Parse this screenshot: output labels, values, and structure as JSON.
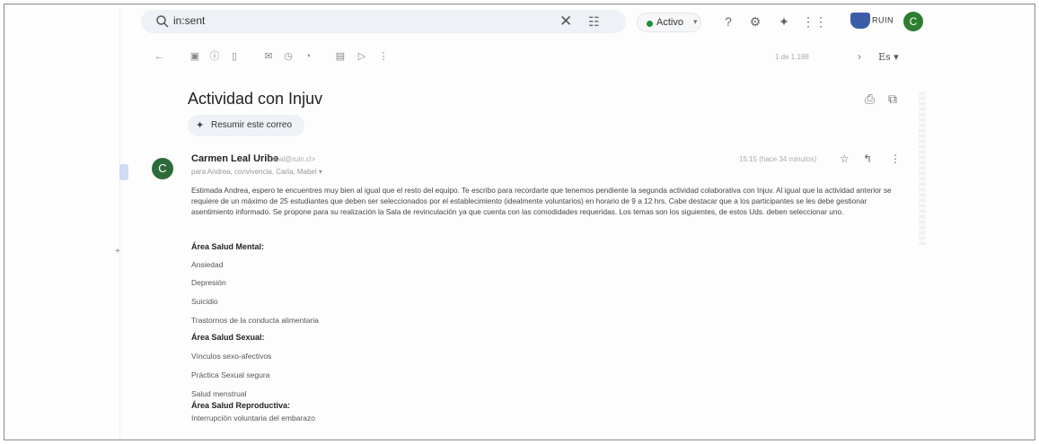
{
  "search": {
    "query": "in:sent",
    "search_icon": "search-icon",
    "clear_icon": "close-icon",
    "filter_icon": "tune-icon"
  },
  "status": {
    "label": "Activo",
    "color": "#1e8e3e"
  },
  "header_icons": [
    "help-icon",
    "settings-icon",
    "gemini-icon",
    "apps-icon"
  ],
  "brand": {
    "label": "RUIN"
  },
  "account": {
    "initial": "C",
    "color": "#2e7d32"
  },
  "toolbar": {
    "icons": [
      "back-icon",
      "archive-icon",
      "report-icon",
      "delete-icon",
      "mark-unread-icon",
      "snooze-icon",
      "add-task-icon",
      "move-icon",
      "label-icon",
      "more-icon"
    ],
    "pager": "1 de 1.188",
    "language": "Es"
  },
  "email": {
    "subject": "Actividad con Injuv",
    "summarize_label": "Resumir este correo",
    "sender_initial": "C",
    "sender_name": "Carmen Leal Uribe",
    "sender_email": "<cleal@ruin.cl>",
    "recipients": "para Andrea, convivencia, Carla, Mabel",
    "time": "15:15 (hace 34 minutos)",
    "body": "Estimada Andrea, espero te encuentres muy bien al igual que el resto del equipo. Te escribo para recordarte que tenemos pendiente la segunda actividad colaborativa con Injuv. Al igual que la actividad anterior se requiere de un máximo de 25 estudiantes que deben ser seleccionados por el establecimiento (idealmente voluntarios) en horario de 9 a 12 hrs. Cabe destacar que a los participantes se les debe gestionar asentimiento informado. Se propone para su realización la Sala de revinculación ya que cuenta con las comodidades requeridas. Los temas son los siguientes, de estos Uds. deben seleccionar uno.",
    "sections": [
      {
        "title": "Área Salud Mental:",
        "items": [
          "Ansiedad",
          "Depresión",
          "Suicidio",
          "Trastornos de la conducta alimentaria"
        ]
      },
      {
        "title": "Área Salud Sexual:",
        "items": [
          "Vínculos sexo-afectivos",
          "Práctica Sexual segura",
          "Salud menstrual"
        ]
      },
      {
        "title": "Área Salud Reproductiva:",
        "items": [
          "Interrupción voluntaria del embarazo"
        ]
      }
    ]
  }
}
